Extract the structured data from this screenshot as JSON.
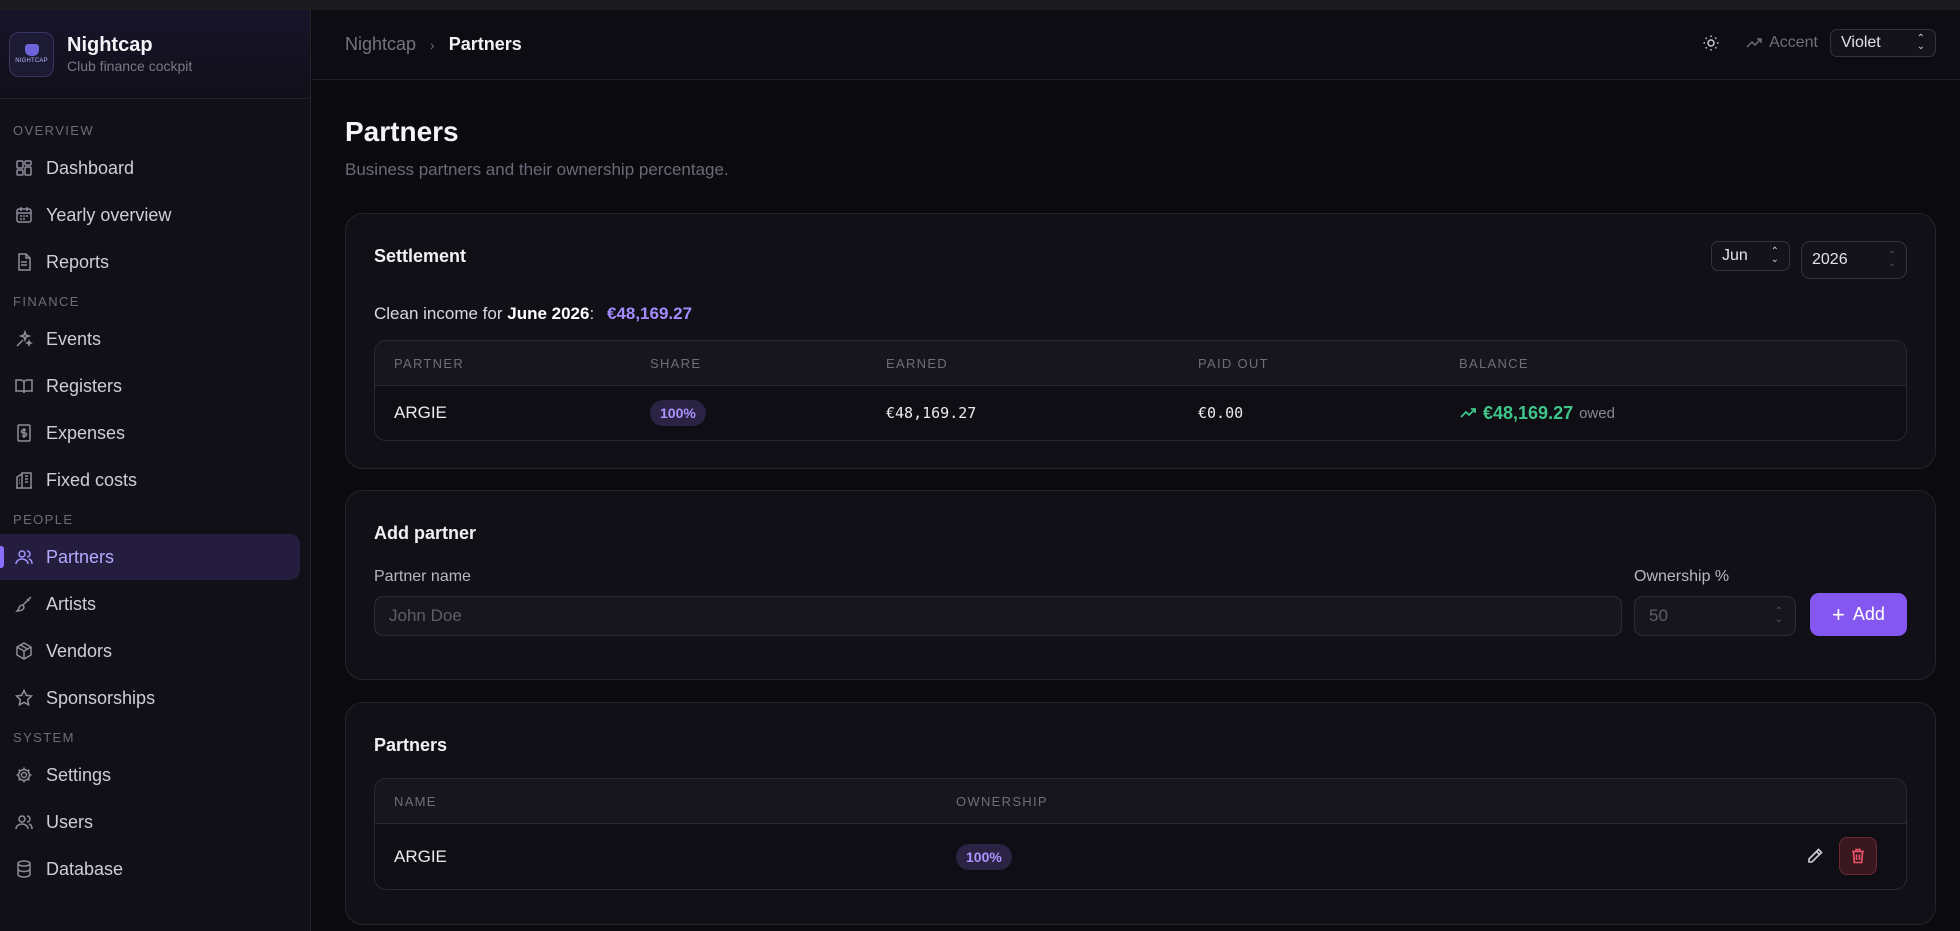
{
  "app": {
    "name": "Nightcap",
    "subtitle": "Club finance cockpit",
    "logo_text": "NIGHTCAP"
  },
  "sidebar": {
    "sections": [
      {
        "title": "OVERVIEW",
        "items": [
          {
            "label": "Dashboard",
            "icon": "dashboard-icon"
          },
          {
            "label": "Yearly overview",
            "icon": "calendar-icon"
          },
          {
            "label": "Reports",
            "icon": "document-icon"
          }
        ]
      },
      {
        "title": "FINANCE",
        "items": [
          {
            "label": "Events",
            "icon": "sparkles-icon"
          },
          {
            "label": "Registers",
            "icon": "book-icon"
          },
          {
            "label": "Expenses",
            "icon": "receipt-icon"
          },
          {
            "label": "Fixed costs",
            "icon": "building-icon"
          }
        ]
      },
      {
        "title": "PEOPLE",
        "items": [
          {
            "label": "Partners",
            "icon": "users-icon",
            "active": true
          },
          {
            "label": "Artists",
            "icon": "brush-icon"
          },
          {
            "label": "Vendors",
            "icon": "package-icon"
          },
          {
            "label": "Sponsorships",
            "icon": "star-icon"
          }
        ]
      },
      {
        "title": "SYSTEM",
        "items": [
          {
            "label": "Settings",
            "icon": "gear-icon"
          },
          {
            "label": "Users",
            "icon": "users-icon"
          },
          {
            "label": "Database",
            "icon": "database-icon"
          }
        ]
      }
    ]
  },
  "header": {
    "breadcrumb_root": "Nightcap",
    "breadcrumb_sep": "›",
    "breadcrumb_current": "Partners",
    "accent_label": "Accent",
    "accent_value": "Violet"
  },
  "page": {
    "title": "Partners",
    "subtitle": "Business partners and their ownership percentage."
  },
  "settlement": {
    "title": "Settlement",
    "month": "Jun",
    "year": "2026",
    "income_prefix": "Clean income for",
    "income_period": "June 2026",
    "income_colon": ":",
    "income_value": "€48,169.27",
    "columns": [
      "PARTNER",
      "SHARE",
      "EARNED",
      "PAID OUT",
      "BALANCE"
    ],
    "rows": [
      {
        "partner": "ARGIE",
        "share": "100%",
        "earned": "€48,169.27",
        "paid_out": "€0.00",
        "balance": "€48,169.27",
        "balance_note": "owed"
      }
    ]
  },
  "add_partner": {
    "title": "Add partner",
    "name_label": "Partner name",
    "name_placeholder": "John Doe",
    "ownership_label": "Ownership %",
    "ownership_placeholder": "50",
    "add_button": "Add"
  },
  "partners": {
    "title": "Partners",
    "columns": [
      "NAME",
      "OWNERSHIP"
    ],
    "rows": [
      {
        "name": "ARGIE",
        "ownership": "100%"
      }
    ]
  },
  "colors": {
    "accent": "#8458f0",
    "positive": "#3fc589",
    "danger": "#f0566a",
    "background": "#0b0b0f"
  }
}
